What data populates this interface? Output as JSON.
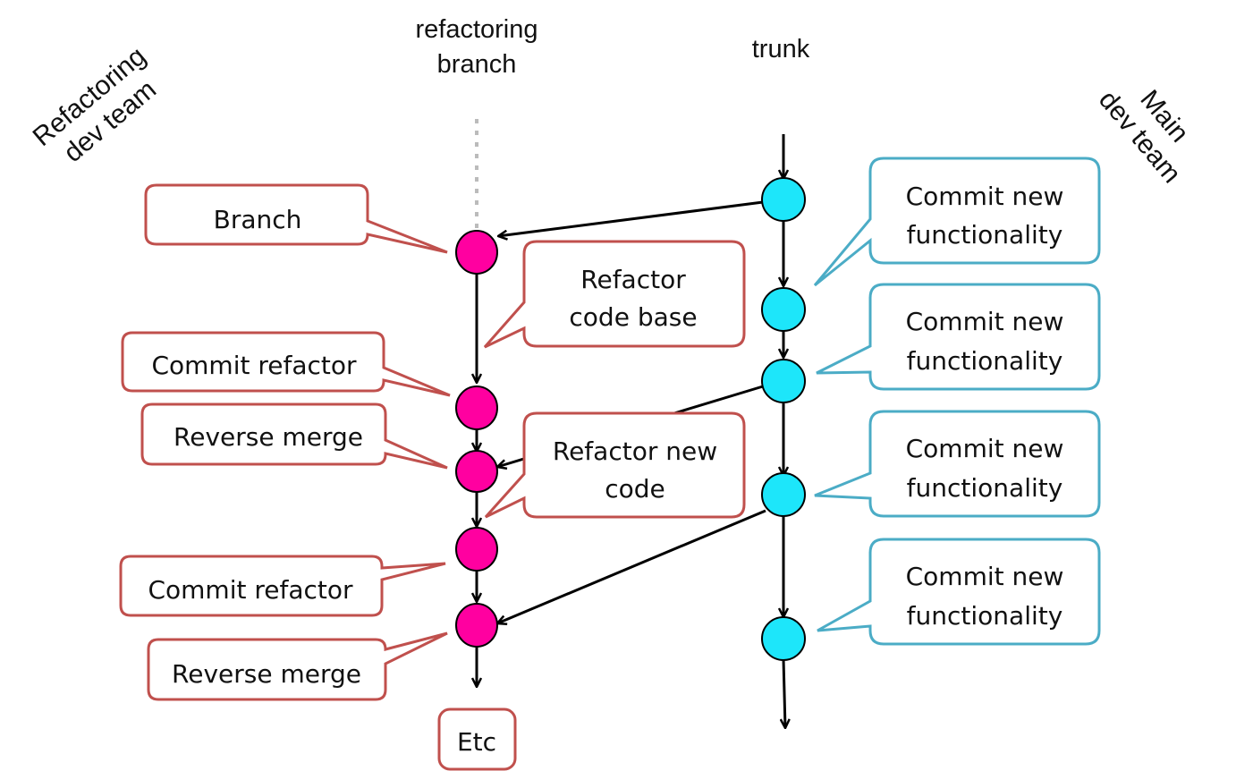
{
  "lanes": {
    "refactoring_branch": {
      "title_line1": "refactoring",
      "title_line2": "branch"
    },
    "trunk": {
      "title": "trunk"
    }
  },
  "teams": {
    "left": {
      "line1": "Refactoring",
      "line2": "dev team"
    },
    "right": {
      "line1": "Main",
      "line2": "dev team"
    }
  },
  "colors": {
    "branch_node": "#ff00a0",
    "trunk_node": "#1de6fa",
    "branch_callout_border": "#c0504d",
    "trunk_callout_border": "#4bacc6",
    "edge": "#000000",
    "dotted_line": "#bbbbbb"
  },
  "branch_callouts": [
    {
      "id": "branch",
      "lines": [
        "Branch"
      ]
    },
    {
      "id": "refactor-code-base",
      "lines": [
        "Refactor",
        "code base"
      ]
    },
    {
      "id": "commit-refactor-1",
      "lines": [
        "Commit refactor"
      ]
    },
    {
      "id": "reverse-merge-1",
      "lines": [
        "Reverse merge"
      ]
    },
    {
      "id": "refactor-new-code",
      "lines": [
        "Refactor new",
        "code"
      ]
    },
    {
      "id": "commit-refactor-2",
      "lines": [
        "Commit refactor"
      ]
    },
    {
      "id": "reverse-merge-2",
      "lines": [
        "Reverse merge"
      ]
    },
    {
      "id": "etc",
      "lines": [
        "Etc"
      ]
    }
  ],
  "trunk_callouts": [
    {
      "id": "commit-new-1",
      "lines": [
        "Commit new",
        "functionality"
      ]
    },
    {
      "id": "commit-new-2",
      "lines": [
        "Commit new",
        "functionality"
      ]
    },
    {
      "id": "commit-new-3",
      "lines": [
        "Commit new",
        "functionality"
      ]
    },
    {
      "id": "commit-new-4",
      "lines": [
        "Commit new",
        "functionality"
      ]
    }
  ]
}
